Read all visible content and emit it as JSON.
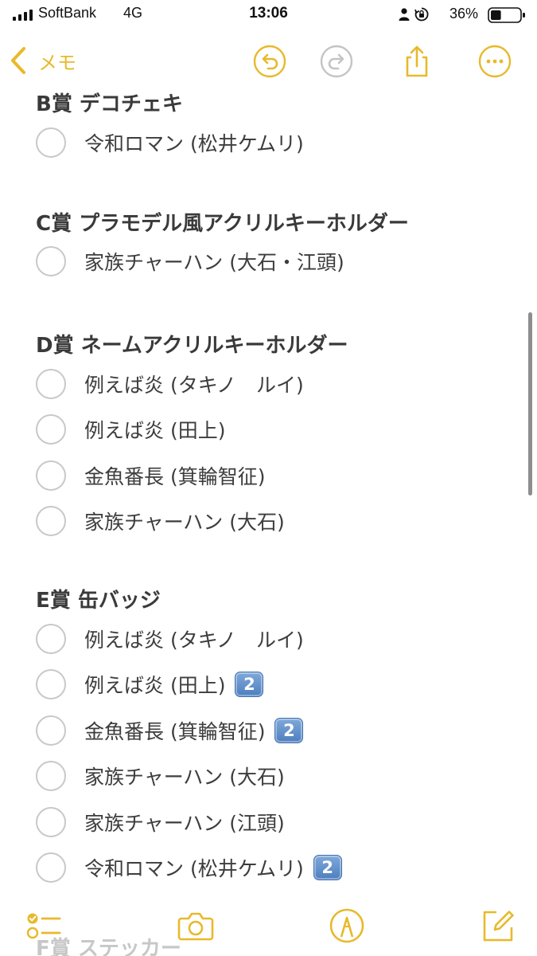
{
  "status": {
    "carrier": "SoftBank",
    "network": "4G",
    "time": "13:06",
    "battery": "36%",
    "battery_level": 0.36
  },
  "nav": {
    "back_label": "メモ",
    "icons": [
      "chevron-left-icon",
      "undo-icon",
      "redo-icon",
      "share-icon",
      "more-icon"
    ]
  },
  "sections": [
    {
      "heading": "B賞 デコチェキ",
      "items": [
        {
          "label": "令和ロマン (松井ケムリ)",
          "badge": ""
        }
      ]
    },
    {
      "heading": "C賞 プラモデル風アクリルキーホルダー",
      "items": [
        {
          "label": "家族チャーハン (大石・江頭)",
          "badge": ""
        }
      ]
    },
    {
      "heading": "D賞 ネームアクリルキーホルダー",
      "items": [
        {
          "label": "例えば炎 (タキノ　ルイ)",
          "badge": ""
        },
        {
          "label": "例えば炎 (田上)",
          "badge": ""
        },
        {
          "label": "金魚番長 (箕輪智征)",
          "badge": ""
        },
        {
          "label": "家族チャーハン (大石)",
          "badge": ""
        }
      ]
    },
    {
      "heading": "E賞 缶バッジ",
      "items": [
        {
          "label": "例えば炎 (タキノ　ルイ)",
          "badge": ""
        },
        {
          "label": "例えば炎 (田上)",
          "badge": "2"
        },
        {
          "label": "金魚番長 (箕輪智征)",
          "badge": "2"
        },
        {
          "label": "家族チャーハン (大石)",
          "badge": ""
        },
        {
          "label": "家族チャーハン (江頭)",
          "badge": ""
        },
        {
          "label": "令和ロマン (松井ケムリ)",
          "badge": "2"
        }
      ]
    }
  ],
  "next_heading_partial": "F賞 ステッカー",
  "toolbar": {
    "icons": [
      "checklist-icon",
      "camera-icon",
      "markup-pen-icon",
      "compose-icon"
    ]
  },
  "colors": {
    "accent": "#e8b92a",
    "text": "#3d3d3d",
    "checkbox_border": "#c8c8c8",
    "keycap": "#5b8ed0"
  }
}
